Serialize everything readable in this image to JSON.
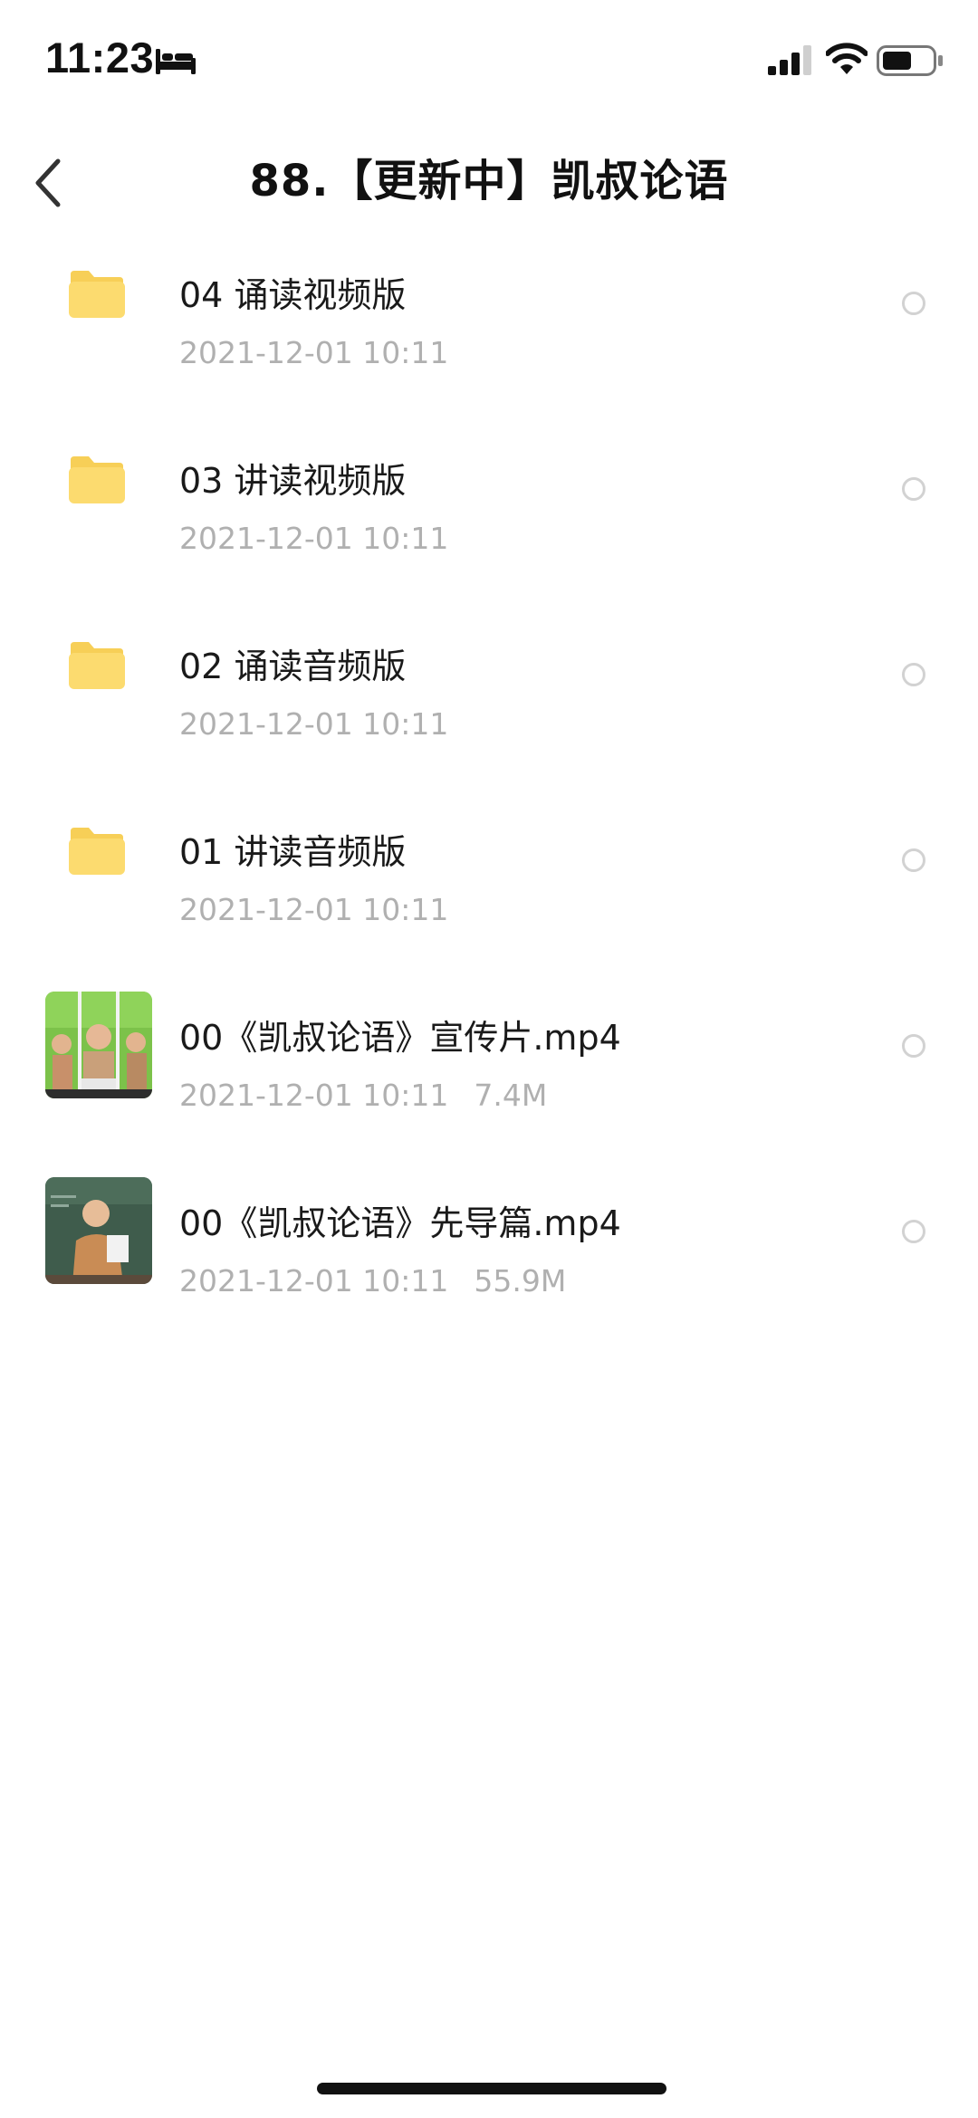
{
  "status_bar": {
    "time": "11:23",
    "icons": [
      "bed-icon",
      "signal-icon",
      "wifi-icon",
      "battery-icon"
    ],
    "battery_level": 0.6
  },
  "header": {
    "title": "88.【更新中】凯叔论语",
    "back_icon": "chevron-left-icon"
  },
  "colors": {
    "folder": "#FCDB6F",
    "folder_tab": "#F7CF57",
    "meta_text": "#B0B0B0",
    "radio_border": "#D2D2D2"
  },
  "items": [
    {
      "type": "folder",
      "name": "04 诵读视频版",
      "date": "2021-12-01 10:11",
      "size": ""
    },
    {
      "type": "folder",
      "name": "03 讲读视频版",
      "date": "2021-12-01 10:11",
      "size": ""
    },
    {
      "type": "folder",
      "name": "02 诵读音频版",
      "date": "2021-12-01 10:11",
      "size": ""
    },
    {
      "type": "folder",
      "name": "01 讲读音频版",
      "date": "2021-12-01 10:11",
      "size": ""
    },
    {
      "type": "video",
      "thumb": "video-thumbnail-green-studio",
      "name": "00《凯叔论语》宣传片.mp4",
      "date": "2021-12-01 10:11",
      "size": "7.4M"
    },
    {
      "type": "video",
      "thumb": "video-thumbnail-classroom",
      "name": "00《凯叔论语》先导篇.mp4",
      "date": "2021-12-01 10:11",
      "size": "55.9M"
    }
  ]
}
